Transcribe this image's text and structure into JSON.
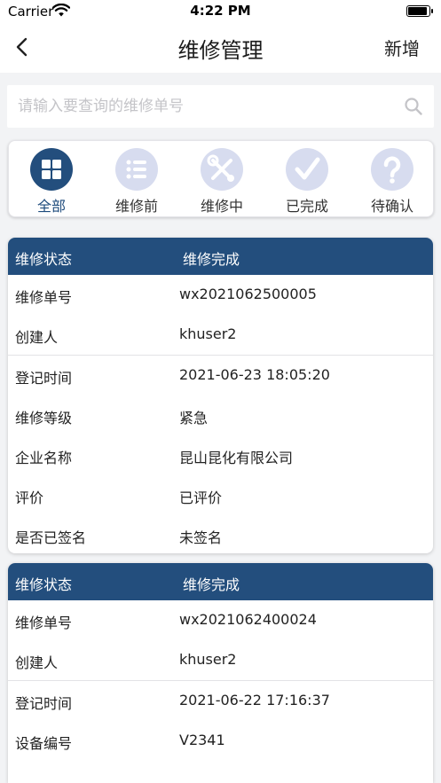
{
  "status_bar": {
    "carrier": "Carrier",
    "time": "4:22 PM"
  },
  "nav": {
    "title": "维修管理",
    "right_label": "新增"
  },
  "search": {
    "placeholder": "请输入要查询的维修单号"
  },
  "filters": [
    {
      "label": "全部",
      "icon": "grid-icon",
      "active": true
    },
    {
      "label": "维修前",
      "icon": "list-icon",
      "active": false
    },
    {
      "label": "维修中",
      "icon": "wrench-screwdriver-icon",
      "active": false
    },
    {
      "label": "已完成",
      "icon": "checkmark-icon",
      "active": false
    },
    {
      "label": "待确认",
      "icon": "question-icon",
      "active": false
    }
  ],
  "colors": {
    "brand": "#234e7d",
    "icon_bg": "#d7dcef",
    "icon_fg": "#ffffff"
  },
  "records": [
    {
      "header": {
        "key": "维修状态",
        "value": "维修完成"
      },
      "rows": [
        {
          "key": "维修单号",
          "value": "wx2021062500005"
        },
        {
          "key": "创建人",
          "value": "khuser2"
        },
        {
          "key": "登记时间",
          "value": "2021-06-23 18:05:20"
        },
        {
          "key": "维修等级",
          "value": "紧急"
        },
        {
          "key": "企业名称",
          "value": "昆山昆化有限公司"
        },
        {
          "key": "评价",
          "value": "已评价"
        },
        {
          "key": "是否已签名",
          "value": "未签名"
        }
      ]
    },
    {
      "header": {
        "key": "维修状态",
        "value": "维修完成"
      },
      "rows": [
        {
          "key": "维修单号",
          "value": "wx2021062400024"
        },
        {
          "key": "创建人",
          "value": "khuser2"
        },
        {
          "key": "登记时间",
          "value": "2021-06-22 17:16:37"
        },
        {
          "key": "设备编号",
          "value": "V2341"
        }
      ]
    }
  ]
}
